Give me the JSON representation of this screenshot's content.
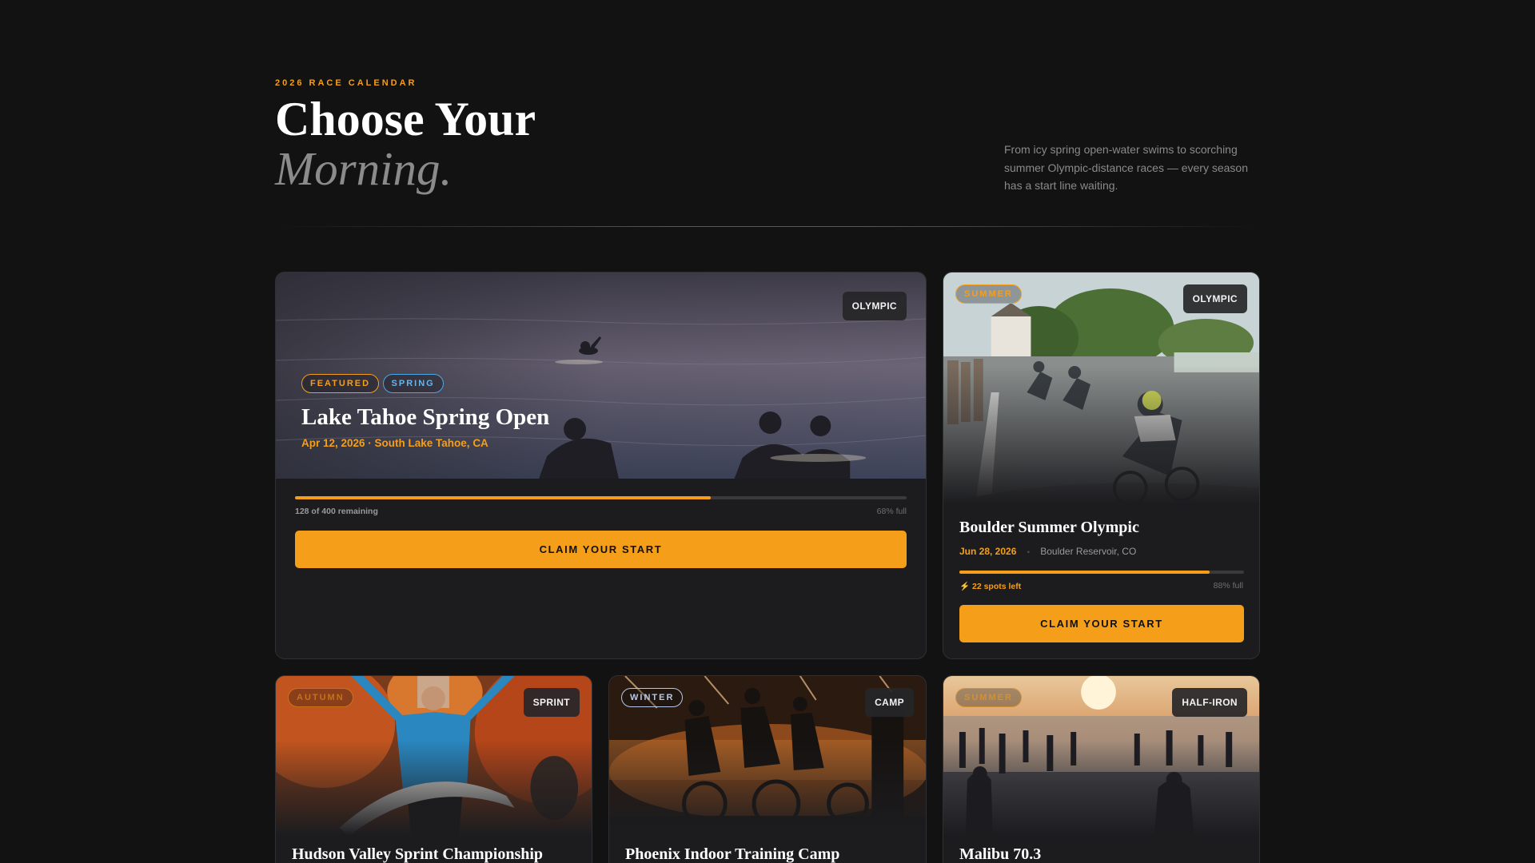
{
  "header": {
    "eyebrow": "2026 RACE CALENDAR",
    "title_line1": "Choose Your",
    "title_line2": "Morning.",
    "intro": "From icy spring open-water swims to scorching summer Olympic-distance races — every season has a start line waiting."
  },
  "colors": {
    "accent": "#f59e1a",
    "background": "#121212",
    "card": "#1c1c1f",
    "spring": "#4da6e6"
  },
  "featured": {
    "tags": [
      "FEATURED",
      "SPRING"
    ],
    "distance": "OLYMPIC",
    "title": "Lake Tahoe Spring Open",
    "meta": "Apr 12, 2026 · South Lake Tahoe, CA",
    "fill_fraction": 0.68,
    "remaining": "128 of 400 remaining",
    "full": "68% full",
    "cta": "CLAIM YOUR START",
    "image_icon": "open-water-swimmers-photo"
  },
  "boulder": {
    "season": "SUMMER",
    "distance": "OLYMPIC",
    "title": "Boulder Summer Olympic",
    "date": "Jun 28, 2026",
    "separator": "•",
    "location": "Boulder Reservoir, CO",
    "fill_fraction": 0.88,
    "spots_icon": "⚡",
    "spots": "22 spots left",
    "full": "88% full",
    "cta": "CLAIM YOUR START",
    "image_icon": "cyclists-race-photo"
  },
  "hudson": {
    "season": "AUTUMN",
    "distance": "SPRINT",
    "title": "Hudson Valley Sprint Championship",
    "image_icon": "finish-line-runner-photo"
  },
  "phoenix": {
    "season": "WINTER",
    "distance": "CAMP",
    "title": "Phoenix Indoor Training Camp",
    "image_icon": "indoor-cycling-photo"
  },
  "malibu": {
    "season": "SUMMER",
    "distance": "HALF-IRON",
    "title": "Malibu 70.3",
    "image_icon": "beach-swim-start-photo"
  }
}
